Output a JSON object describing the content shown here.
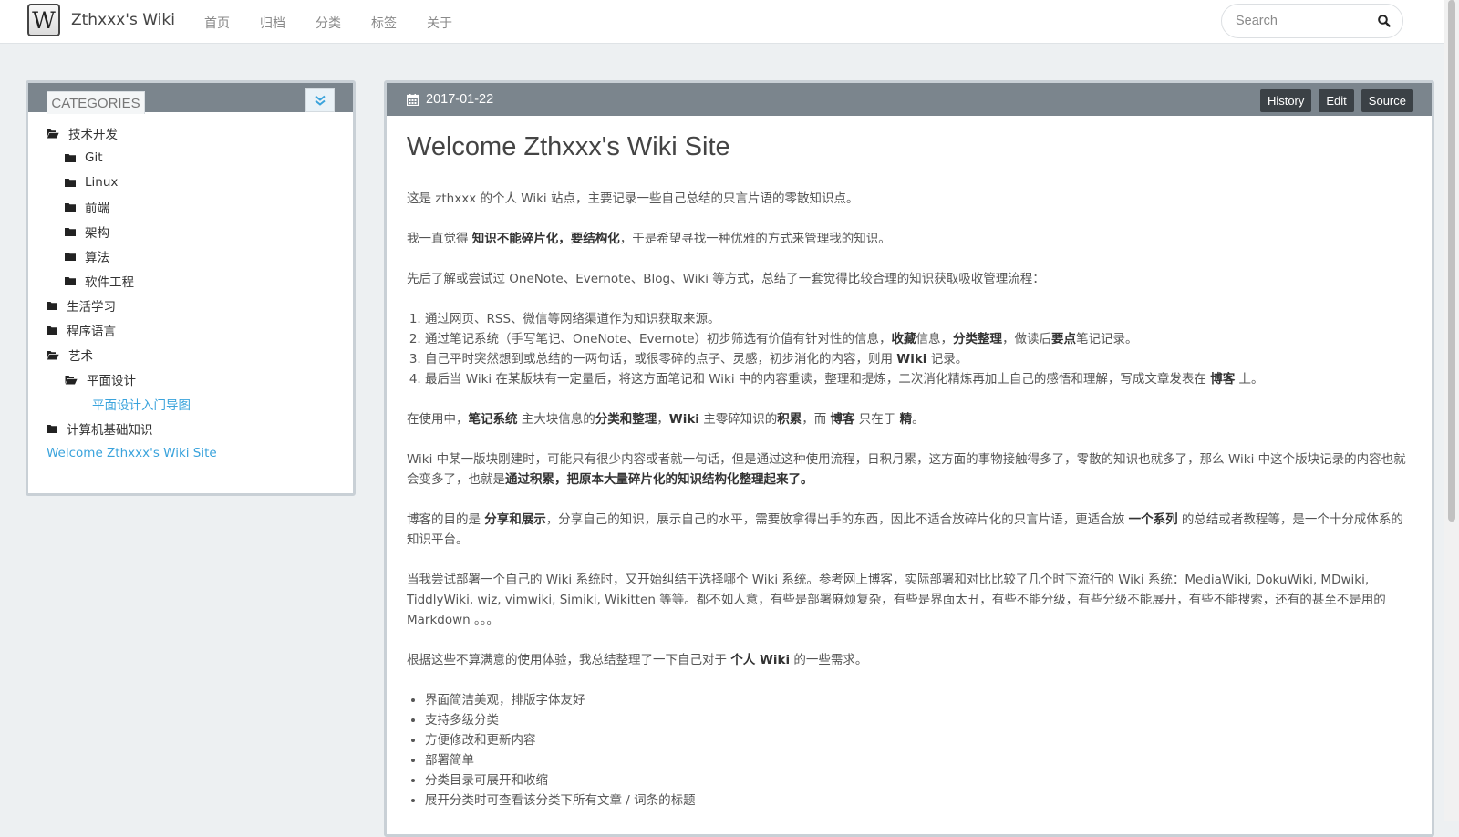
{
  "navbar": {
    "logo_letter": "W",
    "brand": "Zthxxx's Wiki",
    "links": [
      "首页",
      "归档",
      "分类",
      "标签",
      "关于"
    ],
    "search_placeholder": "Search"
  },
  "sidebar": {
    "tab_label": "CATEGORIES",
    "tree": [
      {
        "label": "技术开发",
        "icon": "folder-open-icon"
      },
      {
        "label": "Git",
        "icon": "folder-icon"
      },
      {
        "label": "Linux",
        "icon": "folder-icon"
      },
      {
        "label": "前端",
        "icon": "folder-icon"
      },
      {
        "label": "架构",
        "icon": "folder-icon"
      },
      {
        "label": "算法",
        "icon": "folder-icon"
      },
      {
        "label": "软件工程",
        "icon": "folder-icon"
      },
      {
        "label": "生活学习",
        "icon": "folder-icon"
      },
      {
        "label": "程序语言",
        "icon": "folder-icon"
      },
      {
        "label": "艺术",
        "icon": "folder-open-icon"
      },
      {
        "label": "平面设计",
        "icon": "folder-open-icon"
      },
      {
        "label": "平面设计入门导图",
        "icon": ""
      },
      {
        "label": "计算机基础知识",
        "icon": "folder-icon"
      },
      {
        "label": "Welcome Zthxxx's Wiki Site",
        "icon": ""
      }
    ]
  },
  "article": {
    "date": "2017-01-22",
    "buttons": {
      "history": "History",
      "edit": "Edit",
      "source": "Source"
    },
    "title": "Welcome Zthxxx's Wiki Site",
    "p1": "这是 zthxxx 的个人 Wiki 站点，主要记录一些自己总结的只言片语的零散知识点。",
    "p2": {
      "a": "我一直觉得 ",
      "b": "知识不能碎片化，要结构化",
      "c": "，于是希望寻找一种优雅的方式来管理我的知识。"
    },
    "p3": "先后了解或尝试过 OneNote、Evernote、Blog、Wiki 等方式，总结了一套觉得比较合理的知识获取吸收管理流程：",
    "ol": {
      "i1": "通过网页、RSS、微信等网络渠道作为知识获取来源。",
      "i2a": "通过笔记系统（手写笔记、OneNote、Evernote）初步筛选有价值有针对性的信息，",
      "i2b": "收藏",
      "i2c": "信息，",
      "i2d": "分类整理",
      "i2e": "，做读后",
      "i2f": "要点",
      "i2g": "笔记记录。",
      "i3a": "自己平时突然想到或总结的一两句话，或很零碎的点子、灵感，初步消化的内容，则用 ",
      "i3b": "Wiki",
      "i3c": " 记录。",
      "i4a": "最后当 Wiki 在某版块有一定量后，将这方面笔记和 Wiki 中的内容重读，整理和提炼，二次消化精炼再加上自己的感悟和理解，写成文章发表在 ",
      "i4b": "博客",
      "i4c": " 上。"
    },
    "p4": {
      "a": "在使用中，",
      "b": "笔记系统",
      "c": " 主大块信息的",
      "d": "分类和整理",
      "e": "，",
      "f": "Wiki",
      "g": " 主零碎知识的",
      "h": "积累",
      "i": "，而 ",
      "j": "博客",
      "k": " 只在于 ",
      "l": "精",
      "m": "。"
    },
    "p5": {
      "a": "Wiki 中某一版块刚建时，可能只有很少内容或者就一句话，但是通过这种使用流程，日积月累，这方面的事物接触得多了，零散的知识也就多了，那么 Wiki 中这个版块记录的内容也就会变多了，也就是",
      "b": "通过积累，把原本大量碎片化的知识结构化整理起来了。"
    },
    "p6": {
      "a": "博客的目的是 ",
      "b": "分享和展示",
      "c": "，分享自己的知识，展示自己的水平，需要放拿得出手的东西，因此不适合放碎片化的只言片语，更适合放 ",
      "d": "一个系列",
      "e": " 的总结或者教程等，是一个十分成体系的知识平台。"
    },
    "p7": "当我尝试部署一个自己的 Wiki 系统时，又开始纠结于选择哪个 Wiki 系统。参考网上博客，实际部署和对比比较了几个时下流行的 Wiki 系统：MediaWiki, DokuWiki, MDwiki, TiddlyWiki, wiz, vimwiki, Simiki, Wikitten 等等。都不如人意，有些是部署麻烦复杂，有些是界面太丑，有些不能分级，有些分级不能展开，有些不能搜索，还有的甚至不是用的 Markdown 。。。",
    "p8": {
      "a": "根据这些不算满意的使用体验，我总结整理了一下自己对于 ",
      "b": "个人 Wiki",
      "c": " 的一些需求。"
    },
    "ul": [
      "界面简洁美观，排版字体友好",
      "支持多级分类",
      "方便修改和更新内容",
      "部署简单",
      "分类目录可展开和收缩",
      "展开分类时可查看该分类下所有文章 / 词条的标题"
    ]
  }
}
